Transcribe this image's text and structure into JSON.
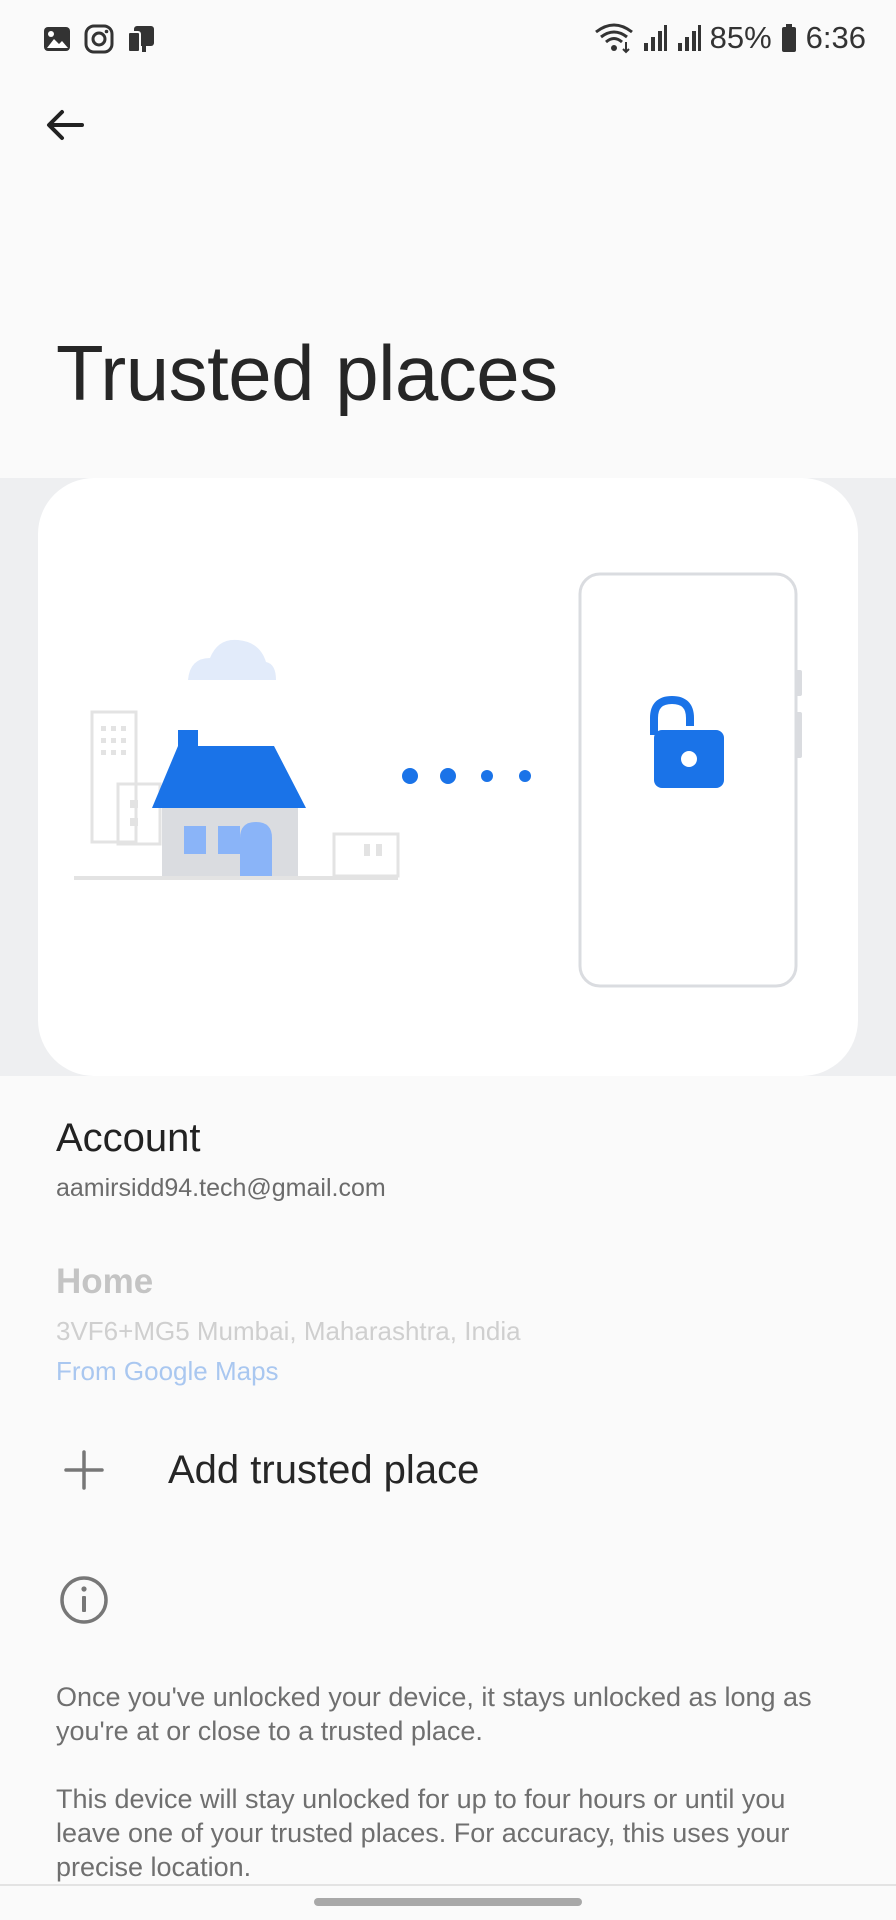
{
  "status_bar": {
    "battery": "85%",
    "time": "6:36",
    "left_icons": [
      "gallery-icon",
      "instagram-icon",
      "devices-icon"
    ],
    "right_icons": [
      "wifi-icon",
      "signal-icon",
      "signal-icon",
      "battery-icon"
    ]
  },
  "header": {
    "title": "Trusted places"
  },
  "account": {
    "label": "Account",
    "email": "aamirsidd94.tech@gmail.com"
  },
  "home": {
    "label": "Home",
    "address": "3VF6+MG5 Mumbai, Maharashtra, India",
    "source": "From Google Maps"
  },
  "add_place": {
    "label": "Add trusted place"
  },
  "info": {
    "paragraph1": "Once you've unlocked your device, it stays unlocked as long as you're at or close to a trusted place.",
    "paragraph2": "This device will stay unlocked for up to four hours or until you leave one of your trusted places. For accuracy, this uses your precise location."
  },
  "colors": {
    "accent": "#1a73e8",
    "title_text": "#262626",
    "body_text": "#6f6f6f"
  }
}
